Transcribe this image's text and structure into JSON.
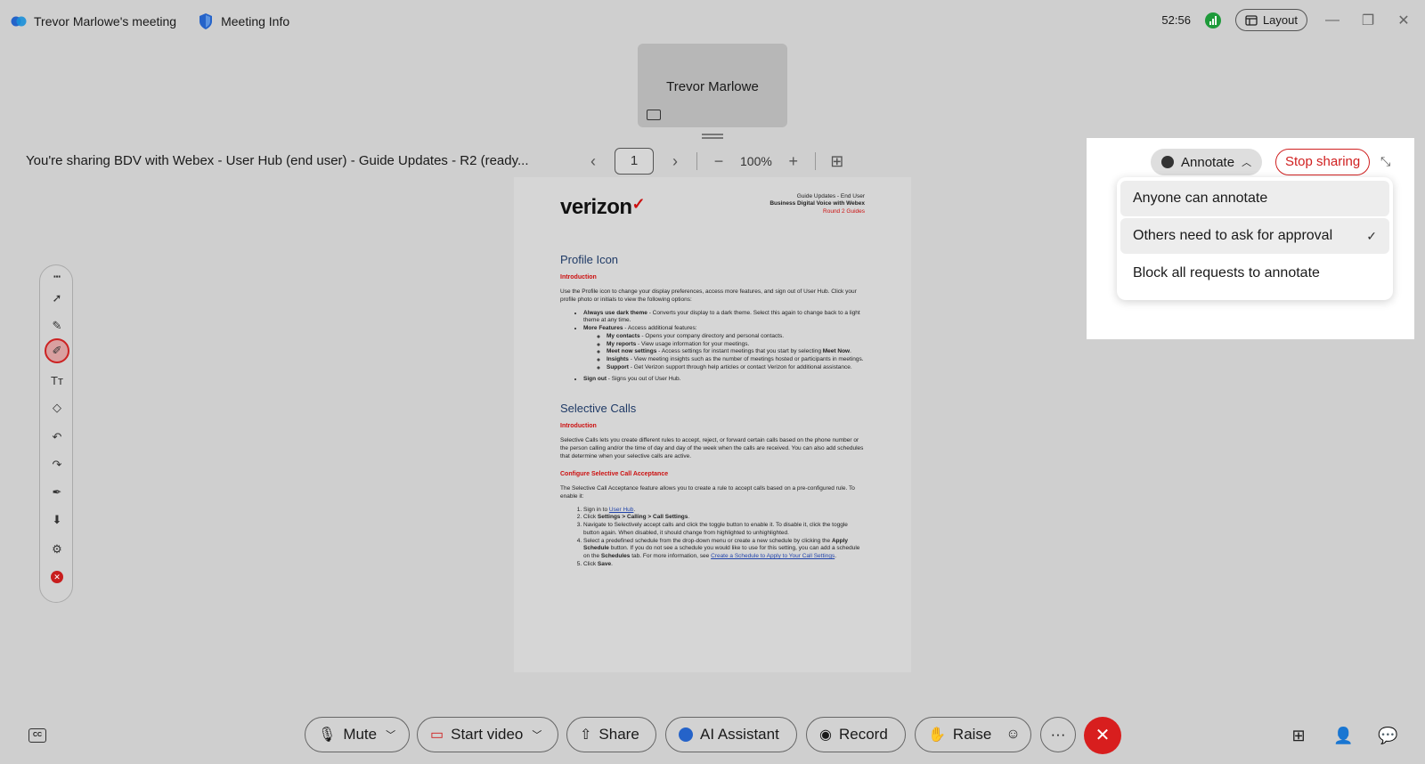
{
  "titlebar": {
    "meeting_title": "Trevor Marlowe's meeting",
    "meeting_info": "Meeting Info",
    "timer": "52:56",
    "layout": "Layout",
    "minimize": "—",
    "restore": "❐",
    "close": "✕"
  },
  "self_view": {
    "name": "Trevor Marlowe"
  },
  "share_bar": {
    "text": "You're sharing BDV with Webex - User Hub (end user) - Guide Updates - R2 (ready...",
    "prev": "‹",
    "page": "1",
    "next": "›",
    "zoom_out": "−",
    "zoom": "100%",
    "zoom_in": "+",
    "grid": "⊞"
  },
  "document": {
    "brand": "verizon",
    "brand_mark": "✓",
    "header": {
      "line1": "Guide Updates - End User",
      "line2": "Business Digital Voice with Webex",
      "line3": "Round 2 Guides"
    },
    "s1_title": "Profile Icon",
    "s1_intro": "Introduction",
    "s1_para": "Use the Profile icon to change your display preferences, access more features, and sign out of User Hub. Click your profile photo or initials to view the following options:",
    "s1_b1_bold": "Always use dark theme",
    "s1_b1": " - Converts your display to a dark theme. Select this again to change back to a light theme at any time.",
    "s1_b2_bold": "More Features",
    "s1_b2": " - Access additional features:",
    "s1_sub1_bold": "My contacts",
    "s1_sub1": " - Opens your company directory and personal contacts.",
    "s1_sub2_bold": "My reports",
    "s1_sub2": " - View usage information for your meetings.",
    "s1_sub3_bold": "Meet now settings",
    "s1_sub3": " - Access settings for instant meetings that you start by selecting ",
    "s1_sub3_end": "Meet Now",
    "s1_sub4_bold": "Insights",
    "s1_sub4": " - View meeting insights such as the number of meetings hosted or participants in meetings.",
    "s1_sub5_bold": "Support",
    "s1_sub5": " - Get Verizon support through help articles or contact Verizon for additional assistance.",
    "s1_b3_bold": "Sign out",
    "s1_b3": " - Signs you out of User Hub.",
    "s2_title": "Selective Calls",
    "s2_intro": "Introduction",
    "s2_para": "Selective Calls lets you create different rules to accept, reject, or forward certain calls based on the phone number or the person calling and/or the time of day and day of the week when the calls are received. You can also add schedules that determine when your selective calls are active.",
    "s2_sub": "Configure Selective Call Acceptance",
    "s2_para2": "The Selective Call Acceptance feature allows you to create a rule to accept calls based on a pre-configured rule. To enable it:",
    "s2_o1": "Sign in to ",
    "s2_o1_link": "User Hub",
    "s2_o2": "Click ",
    "s2_o2_bold": "Settings > Calling > Call Settings",
    "s2_o3": "Navigate to Selectively accept calls and click the toggle button to enable it. To disable it, click the toggle button again. When disabled, it should change from highlighted to unhighlighted.",
    "s2_o4": "Select a predefined schedule from the drop-down menu or create a new schedule by clicking the ",
    "s2_o4_bold": "Apply Schedule",
    "s2_o4b": " button. If you do not see a schedule you would like to use for this setting, you can add a schedule on the ",
    "s2_o4_bold2": "Schedules",
    "s2_o4c": " tab. For more information, see ",
    "s2_o4_link": "Create a Schedule to Apply to Your Call Settings",
    "s2_o5": "Click ",
    "s2_o5_bold": "Save"
  },
  "annotate_panel": {
    "annotate": "Annotate",
    "stop_sharing": "Stop sharing",
    "options": [
      {
        "label": "Anyone can annotate",
        "selected": false
      },
      {
        "label": "Others need to ask for approval",
        "selected": true
      },
      {
        "label": "Block all requests to annotate",
        "selected": false
      }
    ],
    "check": "✓"
  },
  "bottom_bar": {
    "cc": "CC",
    "mute": "Mute",
    "start_video": "Start video",
    "share": "Share",
    "ai_assistant": "AI Assistant",
    "record": "Record",
    "raise": "Raise",
    "more": "···",
    "end": "✕"
  },
  "colors": {
    "accent_red": "#d02020",
    "signal_green": "#1e9a3a",
    "background": "#cfcfcf"
  }
}
